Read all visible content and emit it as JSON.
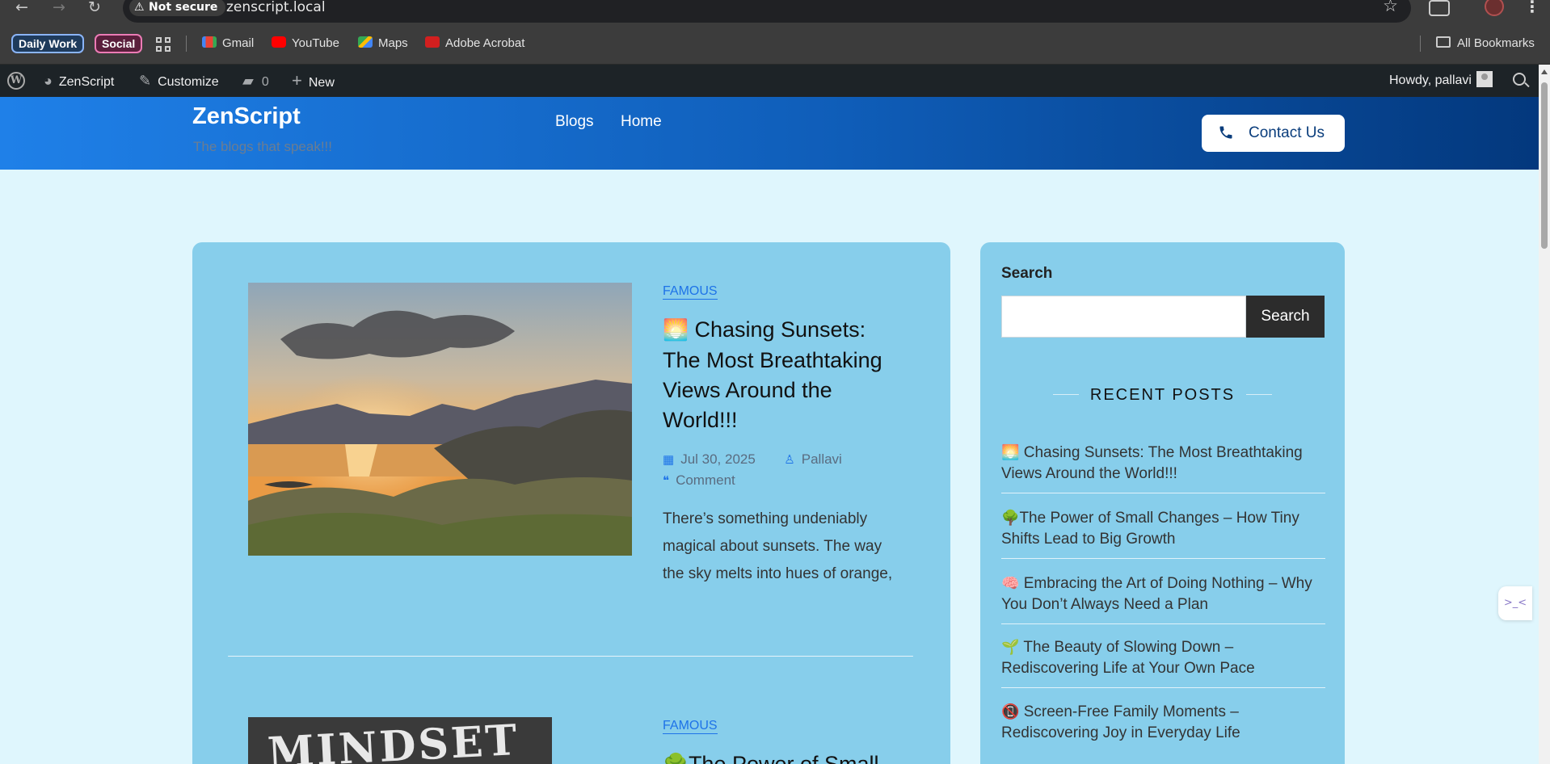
{
  "browser": {
    "not_secure_label": "Not secure",
    "url": "zenscript.local",
    "bookmarks": {
      "group1": "Daily Work",
      "group2": "Social",
      "items": [
        "Gmail",
        "YouTube",
        "Maps",
        "Adobe Acrobat"
      ],
      "all_bookmarks": "All Bookmarks"
    }
  },
  "adminbar": {
    "site_name": "ZenScript",
    "customize": "Customize",
    "comments_count": "0",
    "new_label": "New",
    "howdy": "Howdy, pallavi"
  },
  "header": {
    "site_title": "ZenScript",
    "tagline": "The blogs that speak!!!",
    "menu": [
      "Blogs",
      "Home"
    ],
    "contact_label": "Contact Us"
  },
  "posts": [
    {
      "category": "FAMOUS",
      "title_emoji": "🌅",
      "title": "Chasing Sunsets: The Most Breathtaking Views Around the World!!!",
      "date": "Jul 30, 2025",
      "author": "Pallavi",
      "comment_label": "Comment",
      "excerpt": "There’s something undeniably magical about sunsets. The way the sky melts into hues of orange,"
    },
    {
      "category": "FAMOUS",
      "title_emoji": "🌳",
      "title": "The Power of Small",
      "image_text": "MINDSET"
    }
  ],
  "sidebar": {
    "search_label": "Search",
    "search_button": "Search",
    "recent_heading": "RECENT POSTS",
    "recent_posts": [
      {
        "emoji": "🌅",
        "title": "Chasing Sunsets: The Most Breathtaking Views Around the World!!!"
      },
      {
        "emoji": "🌳",
        "title": "The Power of Small Changes – How Tiny Shifts Lead to Big Growth"
      },
      {
        "emoji": "🧠",
        "title": "Embracing the Art of Doing Nothing – Why You Don’t Always Need a Plan"
      },
      {
        "emoji": "🌱",
        "title": "The Beauty of Slowing Down – Rediscovering Life at Your Own Pace"
      },
      {
        "emoji": "📵",
        "title": "Screen-Free Family Moments – Rediscovering Joy in Everyday Life"
      }
    ]
  },
  "widget": {
    "label": ">_<"
  },
  "colors": {
    "page_bg": "#dff6fd",
    "card_bg": "#87ceeb",
    "header_start": "#1f80e8",
    "header_end": "#03387d",
    "accent": "#1e73e8"
  }
}
